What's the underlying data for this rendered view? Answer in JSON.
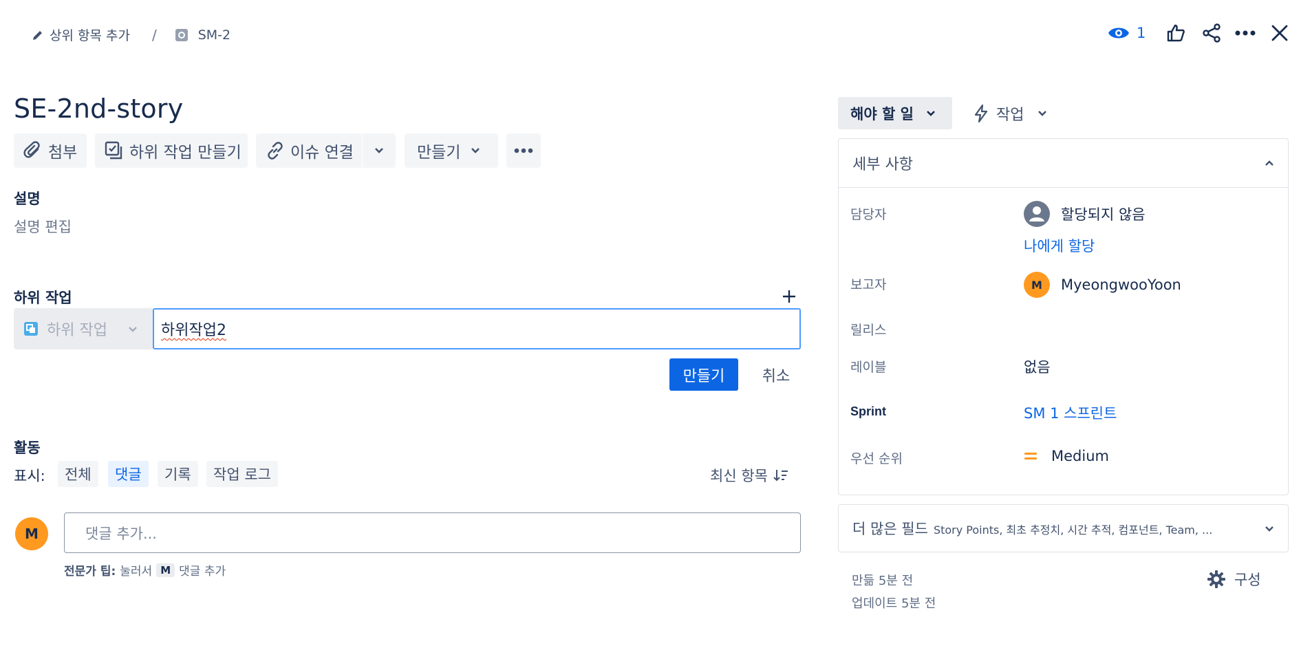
{
  "breadcrumb": {
    "add_parent": "상위 항목 추가",
    "separator": "/",
    "issue_key": "SM-2"
  },
  "header": {
    "watch_count": "1"
  },
  "issue": {
    "title": "SE-2nd-story"
  },
  "toolbar": {
    "attach": "첨부",
    "create_subtask": "하위 작업 만들기",
    "link_issue": "이슈 연결",
    "create": "만들기"
  },
  "description": {
    "heading": "설명",
    "placeholder": "설명 편집"
  },
  "subtasks": {
    "heading": "하위 작업",
    "type_label": "하위 작업",
    "input_value": "하위작업2",
    "create_button": "만들기",
    "cancel_button": "취소"
  },
  "activity": {
    "heading": "활동",
    "show_label": "표시:",
    "filters": [
      "전체",
      "댓글",
      "기록",
      "작업 로그"
    ],
    "active_filter": "댓글",
    "sort_label": "최신 항목",
    "comment_avatar": "M",
    "comment_placeholder": "댓글 추가...",
    "tip_bold": "전문가 팁:",
    "tip_text_before": "눌러서",
    "tip_key": "M",
    "tip_text_after": "댓글 추가"
  },
  "status": {
    "current": "해야 할 일",
    "actions_label": "작업"
  },
  "details": {
    "heading": "세부 사항",
    "assignee_label": "담당자",
    "assignee_value": "할당되지 않음",
    "assign_to_me": "나에게 할당",
    "reporter_label": "보고자",
    "reporter_avatar": "M",
    "reporter_value": "MyeongwooYoon",
    "release_label": "릴리스",
    "labels_label": "레이블",
    "labels_value": "없음",
    "sprint_label": "Sprint",
    "sprint_value": "SM 1 스프린트",
    "priority_label": "우선 순위",
    "priority_value": "Medium"
  },
  "more_fields": {
    "label": "더 많은 필드",
    "summary": "Story Points, 최초 추정치, 시간 추적, 컴포넌트, Team, ..."
  },
  "footer": {
    "created": "만듦 5분 전",
    "updated": "업데이트 5분 전",
    "configure": "구성"
  },
  "colors": {
    "primary": "#0c66e4",
    "avatar_orange": "#ff991f",
    "priority_medium": "#ff991f",
    "focus_border": "#4c9aff",
    "text": "#172b4d",
    "subtle_text": "#5e6c84"
  }
}
